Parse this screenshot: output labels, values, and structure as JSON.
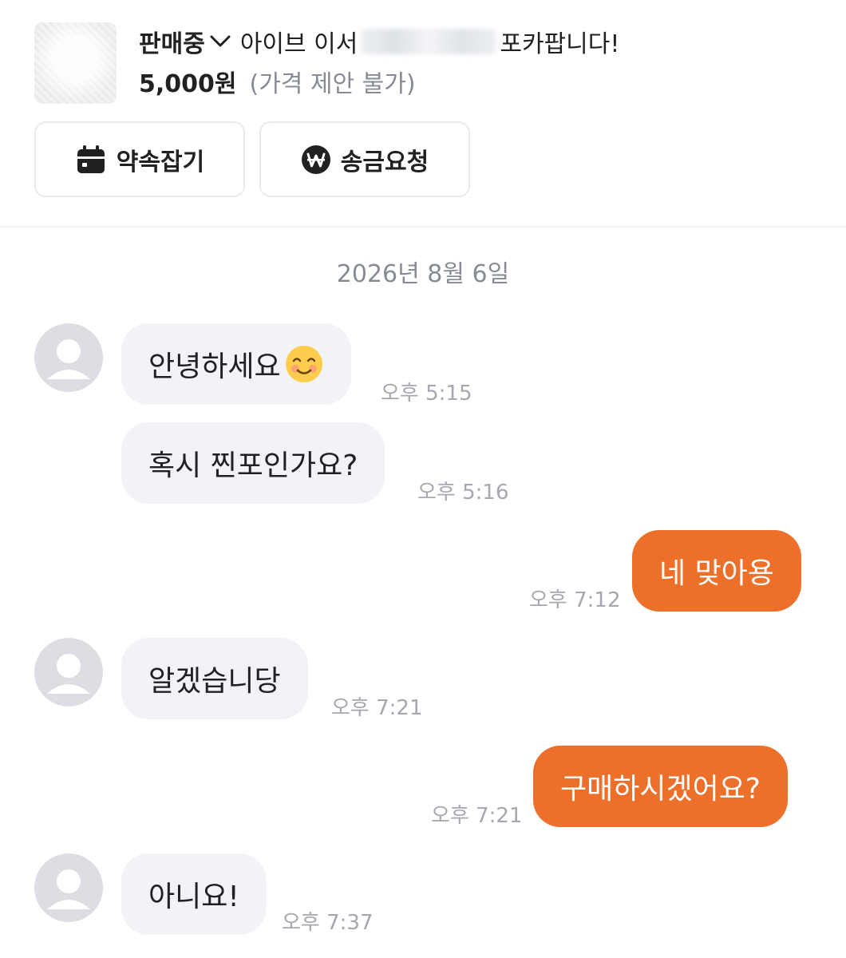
{
  "product": {
    "status": "판매중",
    "title_prefix": "아이브 이서",
    "title_suffix": "포카팝니다!",
    "price": "5,000원",
    "price_note": "(가격 제안 불가)"
  },
  "actions": {
    "appointment_label": "약속잡기",
    "remit_label": "송금요청"
  },
  "chat": {
    "date": "2026년 8월 6일",
    "messages": [
      {
        "sender": "other",
        "text": "안녕하세요",
        "emoji": "smiling-face-icon",
        "time": "오후 5:15"
      },
      {
        "sender": "other",
        "text": "혹시 찐포인가요?",
        "time": "오후 5:16"
      },
      {
        "sender": "me",
        "text": "네 맞아용",
        "time": "오후 7:12"
      },
      {
        "sender": "other",
        "text": "알겠습니당",
        "time": "오후 7:21"
      },
      {
        "sender": "me",
        "text": "구매하시겠어요?",
        "time": "오후 7:21"
      },
      {
        "sender": "other",
        "text": "아니요!",
        "time": "오후 7:37"
      }
    ]
  },
  "colors": {
    "accent": "#ec6f2a",
    "bubble_in": "#f2f3f6",
    "text_primary": "#212124",
    "text_muted": "#868b94"
  }
}
